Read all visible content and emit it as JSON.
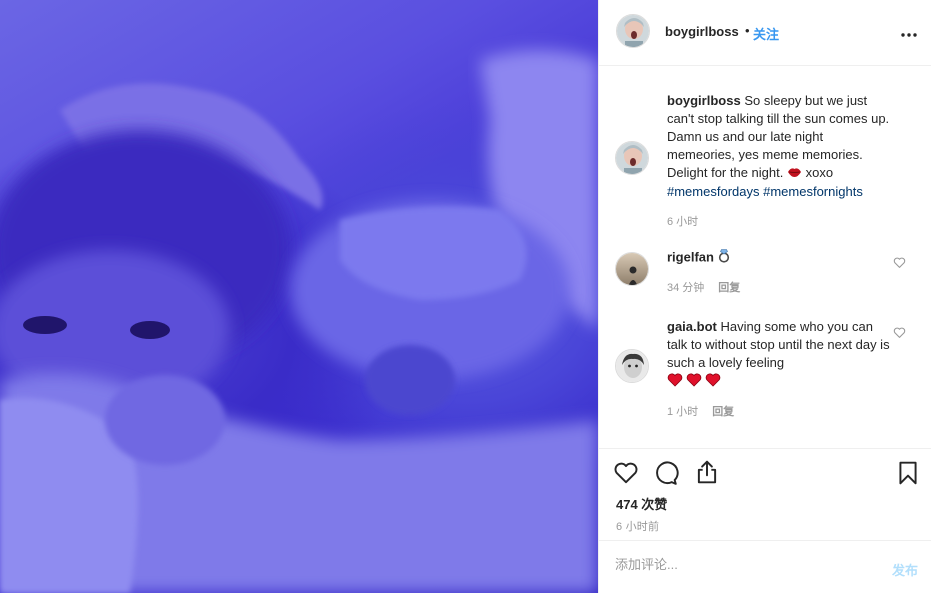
{
  "post": {
    "username": "boygirlboss",
    "separator": "•",
    "follow_label": "关注",
    "more_label": "•••",
    "photo_alt": "photo-post"
  },
  "caption": {
    "username": "boygirlboss",
    "text": "So sleepy but we just can't stop talking till the sun comes up. Damn us and our late night memeories, yes meme memories. Delight for the night.",
    "tail": "xoxo",
    "hashtags": [
      "#memesfordays",
      "#memesfornights"
    ],
    "time": "6 小时"
  },
  "comments": [
    {
      "username": "rigelfan",
      "text": "",
      "time": "34 分钟",
      "reply": "回复",
      "emoji": "ring"
    },
    {
      "username": "gaia.bot",
      "text": "Having some who you can talk to without stop until the next day is such a lovely feeling",
      "time": "1 小时",
      "reply": "回复",
      "emoji": "three-hearts"
    }
  ],
  "actions": {
    "likes": "474 次赞",
    "time": "6 小时前"
  },
  "add_comment": {
    "placeholder": "添加评论...",
    "post_label": "发布"
  },
  "colors": {
    "accent": "#3897f0",
    "hashtag": "#003569",
    "muted": "#999999",
    "post_disabled": "#b2dffc"
  }
}
